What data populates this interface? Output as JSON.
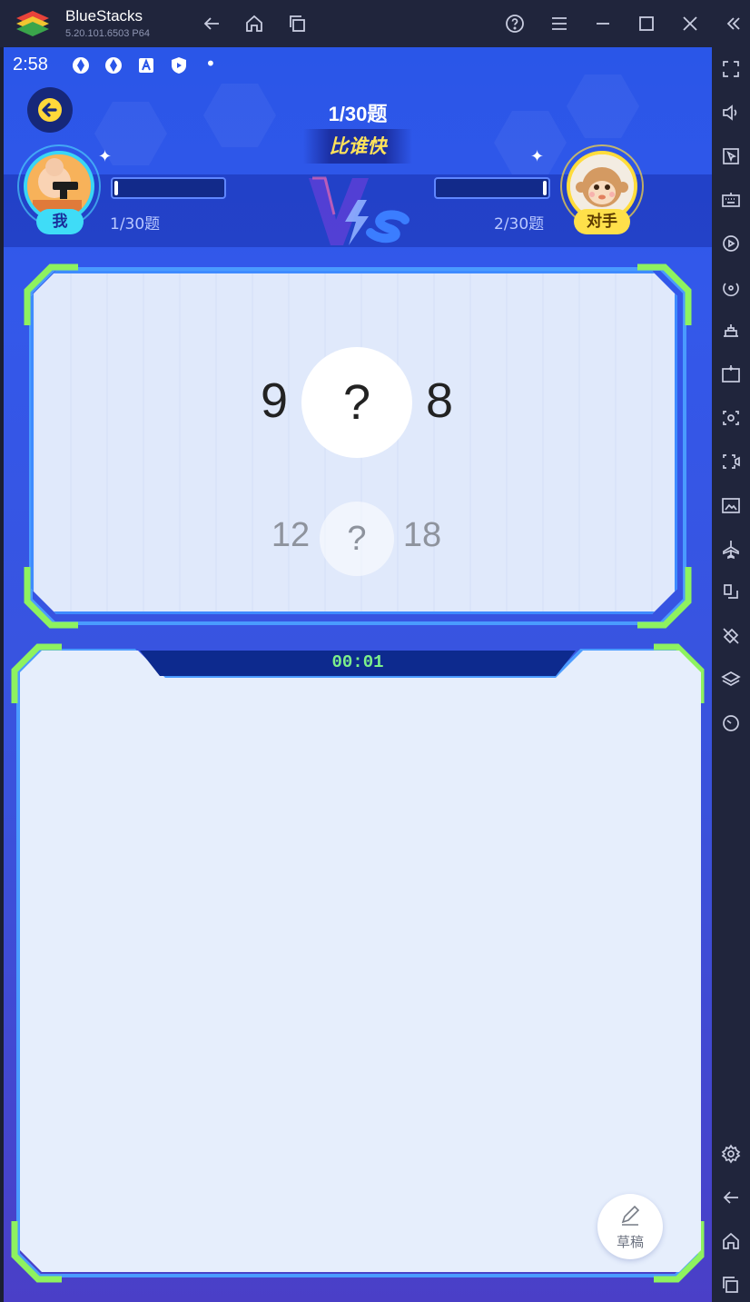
{
  "window": {
    "app_name": "BlueStacks",
    "version": "5.20.101.6503  P64"
  },
  "status_bar": {
    "time": "2:58",
    "dot": "•"
  },
  "game": {
    "progress": "1/30题",
    "mode": "比谁快",
    "player_me": {
      "name": "我",
      "count": "1/30题",
      "progress_fraction": 0.03
    },
    "player_opponent": {
      "name": "对手",
      "count": "2/30题",
      "progress_fraction": 0.03
    }
  },
  "question": {
    "current": {
      "left": "9",
      "operator": "?",
      "right": "8"
    },
    "next": {
      "left": "12",
      "operator": "?",
      "right": "18"
    }
  },
  "answer_area": {
    "timer": "00:01",
    "draft_label": "草稿"
  },
  "colors": {
    "accent": "#3f8bff",
    "frame_green": "#8ef25f",
    "timer_green": "#7df08a",
    "me_tag": "#3fdcf7",
    "opponent_tag": "#ffe04a"
  }
}
